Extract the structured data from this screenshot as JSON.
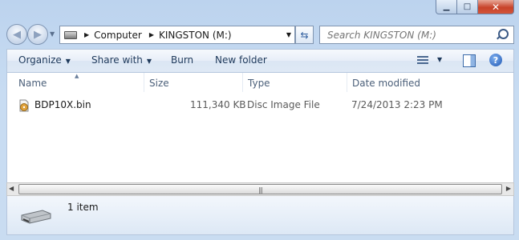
{
  "window": {
    "controls": {
      "minimize": "▁",
      "maximize": "□",
      "close": "✕"
    }
  },
  "nav": {
    "back_icon": "back-arrow-icon",
    "forward_icon": "forward-arrow-icon",
    "breadcrumb": [
      "Computer",
      "KINGSTON (M:)"
    ]
  },
  "search": {
    "placeholder": "Search KINGSTON (M:)"
  },
  "commands": {
    "organize": "Organize",
    "share_with": "Share with",
    "burn": "Burn",
    "new_folder": "New folder"
  },
  "columns": {
    "name": "Name",
    "size": "Size",
    "type": "Type",
    "date_modified": "Date modified"
  },
  "files": [
    {
      "name": "BDP10X.bin",
      "size": "111,340 KB",
      "type": "Disc Image File",
      "date_modified": "7/24/2013 2:23 PM"
    }
  ],
  "details": {
    "item_count": "1 item"
  },
  "colors": {
    "accent": "#1e395b",
    "frame": "#c9dcf1",
    "close": "#c7432a"
  }
}
